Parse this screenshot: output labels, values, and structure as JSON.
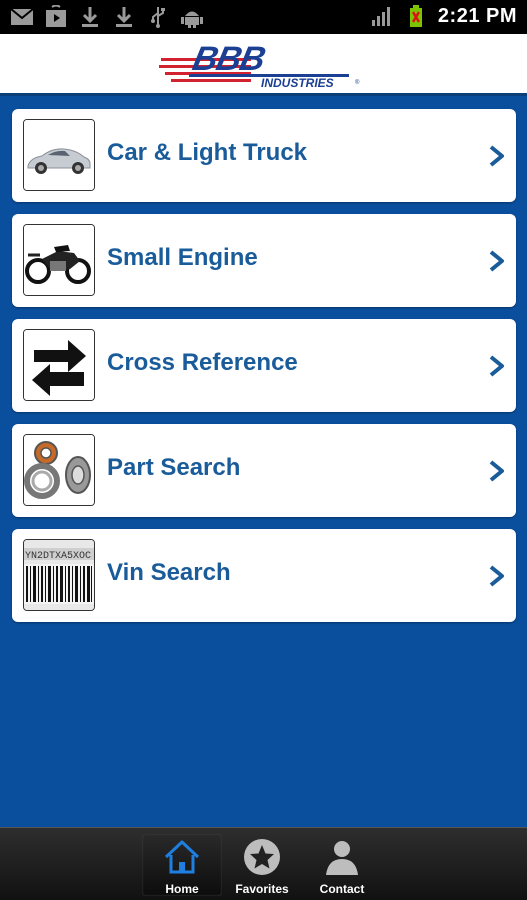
{
  "status_bar": {
    "time": "2:21 PM",
    "left_icons": [
      "gmail-icon",
      "play-store-icon",
      "download-icon",
      "download-icon",
      "usb-icon",
      "android-icon"
    ],
    "right_icons": [
      "signal-icon",
      "battery-icon"
    ]
  },
  "header": {
    "logo_main": "BBB",
    "logo_sub": "INDUSTRIES",
    "brand_colors": {
      "blue": "#1a3f93",
      "red": "#d2222f"
    }
  },
  "menu": {
    "items": [
      {
        "label": "Car & Light Truck",
        "icon": "car-icon"
      },
      {
        "label": "Small Engine",
        "icon": "motorcycle-icon"
      },
      {
        "label": "Cross Reference",
        "icon": "swap-arrows-icon"
      },
      {
        "label": "Part Search",
        "icon": "bearing-icon"
      },
      {
        "label": "Vin Search",
        "icon": "vin-barcode-icon"
      }
    ]
  },
  "tabbar": {
    "tabs": [
      {
        "label": "Home",
        "icon": "home-icon",
        "active": true
      },
      {
        "label": "Favorites",
        "icon": "star-icon",
        "active": false
      },
      {
        "label": "Contact",
        "icon": "person-icon",
        "active": false
      }
    ]
  },
  "colors": {
    "background_blue": "#0a4f9e",
    "label_blue": "#1a5b9a"
  }
}
